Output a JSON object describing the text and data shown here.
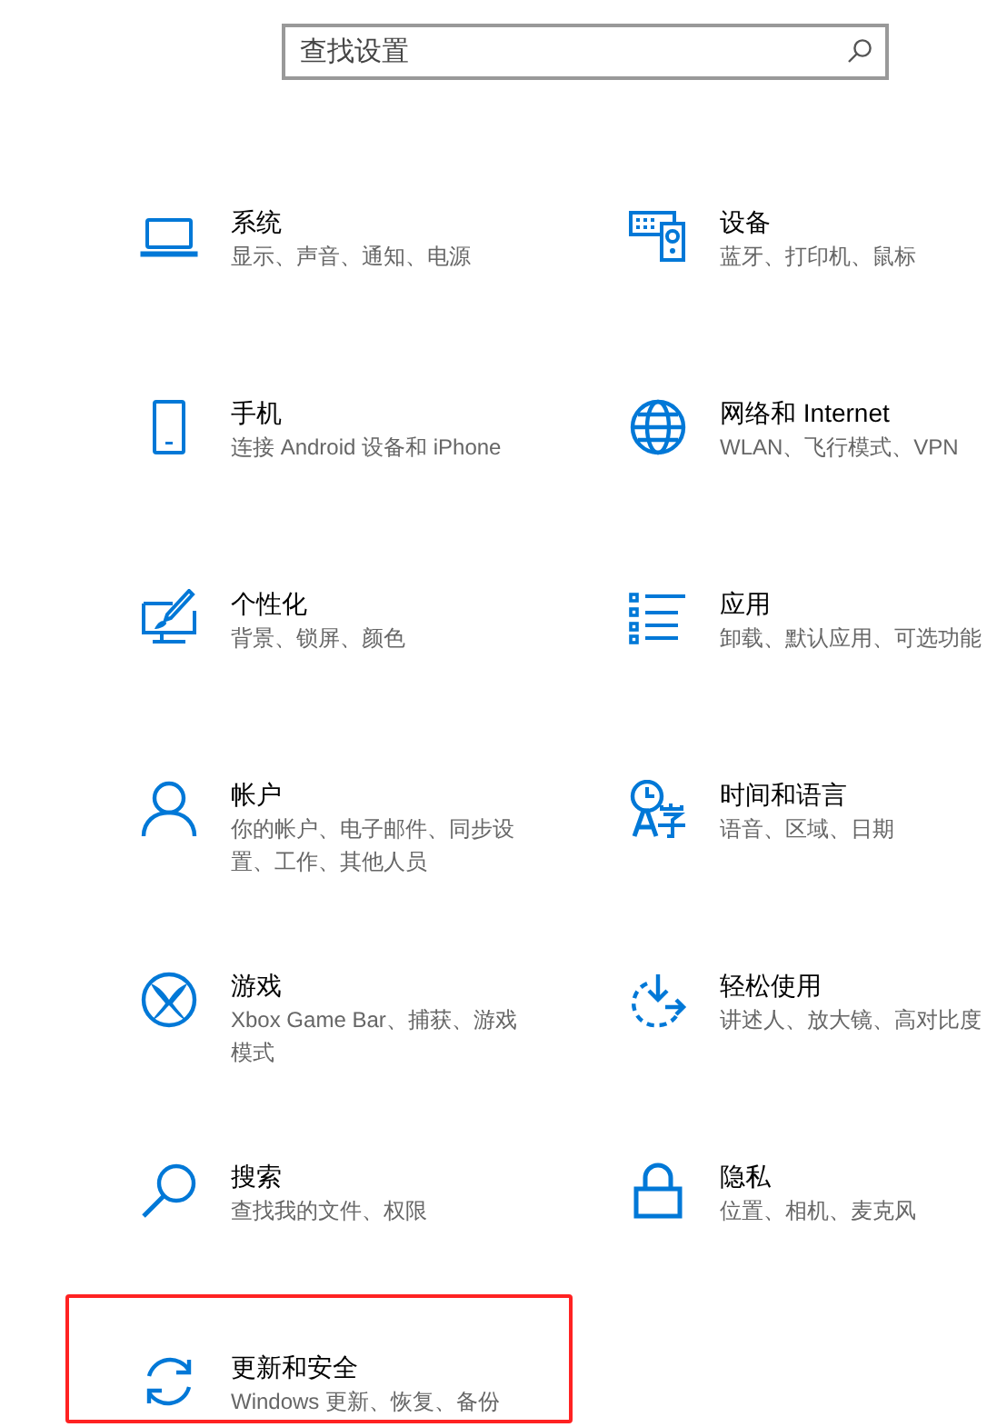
{
  "search": {
    "placeholder": "查找设置"
  },
  "categories": [
    {
      "title": "系统",
      "description": "显示、声音、通知、电源",
      "highlighted": false
    },
    {
      "title": "设备",
      "description": "蓝牙、打印机、鼠标",
      "highlighted": false
    },
    {
      "title": "手机",
      "description": "连接 Android 设备和 iPhone",
      "highlighted": false
    },
    {
      "title": "网络和 Internet",
      "description": "WLAN、飞行模式、VPN",
      "highlighted": false
    },
    {
      "title": "个性化",
      "description": "背景、锁屏、颜色",
      "highlighted": false
    },
    {
      "title": "应用",
      "description": "卸载、默认应用、可选功能",
      "highlighted": false
    },
    {
      "title": "帐户",
      "description": "你的帐户、电子邮件、同步设置、工作、其他人员",
      "highlighted": false
    },
    {
      "title": "时间和语言",
      "description": "语音、区域、日期",
      "highlighted": false
    },
    {
      "title": "游戏",
      "description": "Xbox Game Bar、捕获、游戏模式",
      "highlighted": false
    },
    {
      "title": "轻松使用",
      "description": "讲述人、放大镜、高对比度",
      "highlighted": false
    },
    {
      "title": "搜索",
      "description": "查找我的文件、权限",
      "highlighted": false
    },
    {
      "title": "隐私",
      "description": "位置、相机、麦克风",
      "highlighted": false
    },
    {
      "title": "更新和安全",
      "description": "Windows 更新、恢复、备份",
      "highlighted": true
    }
  ]
}
